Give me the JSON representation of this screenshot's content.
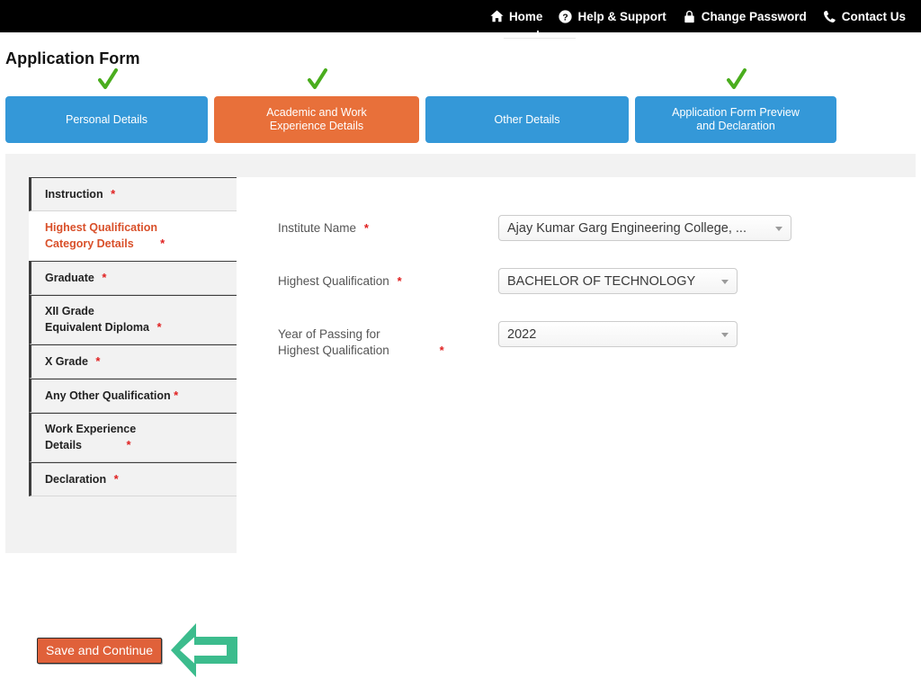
{
  "topnav": {
    "items": [
      {
        "label": "Home",
        "icon": "home-icon"
      },
      {
        "label": "Help & Support",
        "icon": "question-circle-icon"
      },
      {
        "label": "Change Password",
        "icon": "lock-icon"
      },
      {
        "label": "Contact Us",
        "icon": "phone-icon"
      }
    ]
  },
  "page": {
    "title": "Application Form"
  },
  "tabs": [
    {
      "label_line1": "Personal Details",
      "label_line2": "",
      "state": "complete",
      "color": "#3498d8",
      "check": true
    },
    {
      "label_line1": "Academic and Work",
      "label_line2": "Experience Details",
      "state": "active",
      "color": "#e8703a",
      "check": true
    },
    {
      "label_line1": "Other Details",
      "label_line2": "",
      "state": "pending",
      "color": "#3498d8",
      "check": false
    },
    {
      "label_line1": "Application Form Preview",
      "label_line2": "and Declaration",
      "state": "complete",
      "color": "#3498d8",
      "check": true
    }
  ],
  "sidebar": {
    "items": [
      {
        "line1": "Instruction",
        "line2": "",
        "required": "*",
        "active": false,
        "ast_offset": "inline"
      },
      {
        "line1": "Highest Qualification",
        "line2": "Category Details",
        "required": "*",
        "active": true,
        "ast_offset": "far"
      },
      {
        "line1": "Graduate",
        "line2": "",
        "required": "*",
        "active": false,
        "ast_offset": "inline"
      },
      {
        "line1": "XII Grade",
        "line2": "Equivalent Diploma",
        "required": "*",
        "active": false,
        "ast_offset": "inline"
      },
      {
        "line1": "X Grade",
        "line2": "",
        "required": "*",
        "active": false,
        "ast_offset": "inline"
      },
      {
        "line1": "Any Other Qualification",
        "line2": "",
        "required": "*",
        "active": false,
        "ast_offset": "tight"
      },
      {
        "line1": "Work Experience",
        "line2": "Details",
        "required": "*",
        "active": false,
        "ast_offset": "far"
      },
      {
        "line1": "Declaration",
        "line2": "",
        "required": "*",
        "active": false,
        "ast_offset": "inline"
      }
    ],
    "save_button": "Save and Continue",
    "pointer_icon": "left-arrow-annotation"
  },
  "form": {
    "fields": [
      {
        "label_line1": "Institute Name",
        "label_line2": "",
        "required": "*",
        "value": "Ajay Kumar Garg Engineering College, ...",
        "control": "select"
      },
      {
        "label_line1": "Highest Qualification",
        "label_line2": "",
        "required": "*",
        "value": "BACHELOR OF TECHNOLOGY",
        "control": "select"
      },
      {
        "label_line1": "Year of Passing for",
        "label_line2": "Highest Qualification",
        "required": "*",
        "value": "2022",
        "control": "select"
      }
    ]
  },
  "colors": {
    "nav_bg": "#000000",
    "tab_blue": "#3498d8",
    "tab_orange": "#e8703a",
    "active_text": "#d9502a",
    "required_red": "#e02020",
    "save_button": "#e0613a",
    "arrow_green": "#3cbc8d",
    "check_green": "#4aad1e",
    "panel_grey": "#f2f2f2"
  }
}
